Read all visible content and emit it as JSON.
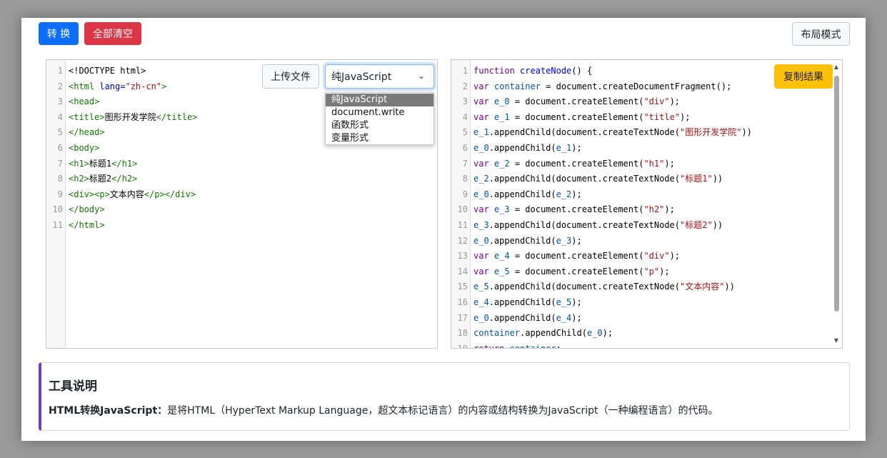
{
  "toolbar": {
    "convert_label": "转 换",
    "clear_label": "全部清空",
    "layout_label": "布局模式"
  },
  "input_panel": {
    "upload_label": "上传文件",
    "select_value": "纯JavaScript",
    "options": [
      "纯JavaScript",
      "document.write",
      "函数形式",
      "变量形式"
    ]
  },
  "output_panel": {
    "copy_label": "复制结果"
  },
  "info": {
    "title": "工具说明",
    "text_bold": "HTML转换JavaScript：",
    "text": "是将HTML（HyperText Markup Language，超文本标记语言）的内容或结构转换为JavaScript（一种编程语言）的代码。"
  },
  "colors": {
    "primary": "#0d6efd",
    "danger": "#dc3545",
    "warning": "#ffc107",
    "accent_border": "#6f42c1"
  }
}
